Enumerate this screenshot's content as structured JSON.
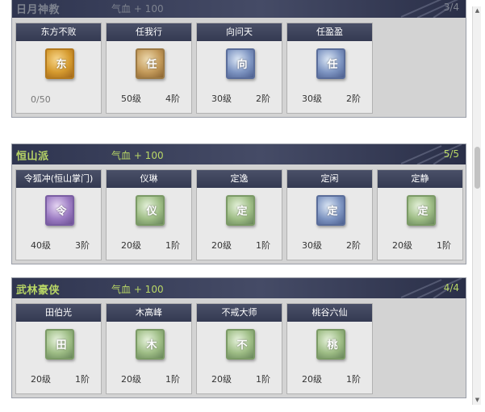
{
  "groups": [
    {
      "name": "日月神教",
      "bonus": "气血 + 100",
      "count": "3/4",
      "active": false,
      "cards": [
        {
          "name": "东方不败",
          "icon": "gold",
          "glyph": "东",
          "progress": "0/50"
        },
        {
          "name": "任我行",
          "icon": "bronze",
          "glyph": "任",
          "level": "50级",
          "stage": "4阶"
        },
        {
          "name": "向问天",
          "icon": "blue",
          "glyph": "向",
          "level": "30级",
          "stage": "2阶"
        },
        {
          "name": "任盈盈",
          "icon": "blue",
          "glyph": "任",
          "level": "30级",
          "stage": "2阶"
        }
      ]
    },
    {
      "name": "恒山派",
      "bonus": "气血 + 100",
      "count": "5/5",
      "active": true,
      "cards": [
        {
          "name": "令狐冲(恒山掌门)",
          "icon": "purple",
          "glyph": "令",
          "level": "40级",
          "stage": "3阶"
        },
        {
          "name": "仪琳",
          "icon": "green",
          "glyph": "仪",
          "level": "20级",
          "stage": "1阶"
        },
        {
          "name": "定逸",
          "icon": "green",
          "glyph": "定",
          "level": "20级",
          "stage": "1阶"
        },
        {
          "name": "定闲",
          "icon": "blue",
          "glyph": "定",
          "level": "30级",
          "stage": "2阶"
        },
        {
          "name": "定静",
          "icon": "green",
          "glyph": "定",
          "level": "20级",
          "stage": "1阶"
        }
      ]
    },
    {
      "name": "武林豪侠",
      "bonus": "气血 + 100",
      "count": "4/4",
      "active": true,
      "cards": [
        {
          "name": "田伯光",
          "icon": "green",
          "glyph": "田",
          "level": "20级",
          "stage": "1阶"
        },
        {
          "name": "木高峰",
          "icon": "green",
          "glyph": "木",
          "level": "20级",
          "stage": "1阶"
        },
        {
          "name": "不戒大师",
          "icon": "green",
          "glyph": "不",
          "level": "20级",
          "stage": "1阶"
        },
        {
          "name": "桃谷六仙",
          "icon": "green",
          "glyph": "桃",
          "level": "20级",
          "stage": "1阶"
        }
      ]
    }
  ],
  "scrollbar": {
    "up_icon": "arrow-up-icon",
    "down_icon": "arrow-down-icon"
  },
  "colors": {
    "header_text": "#b9d766",
    "header_dim": "#7e838f",
    "header_bg": "#343a52",
    "panel_bg": "#d3d3d3",
    "card_bg": "#e9e9e9"
  }
}
